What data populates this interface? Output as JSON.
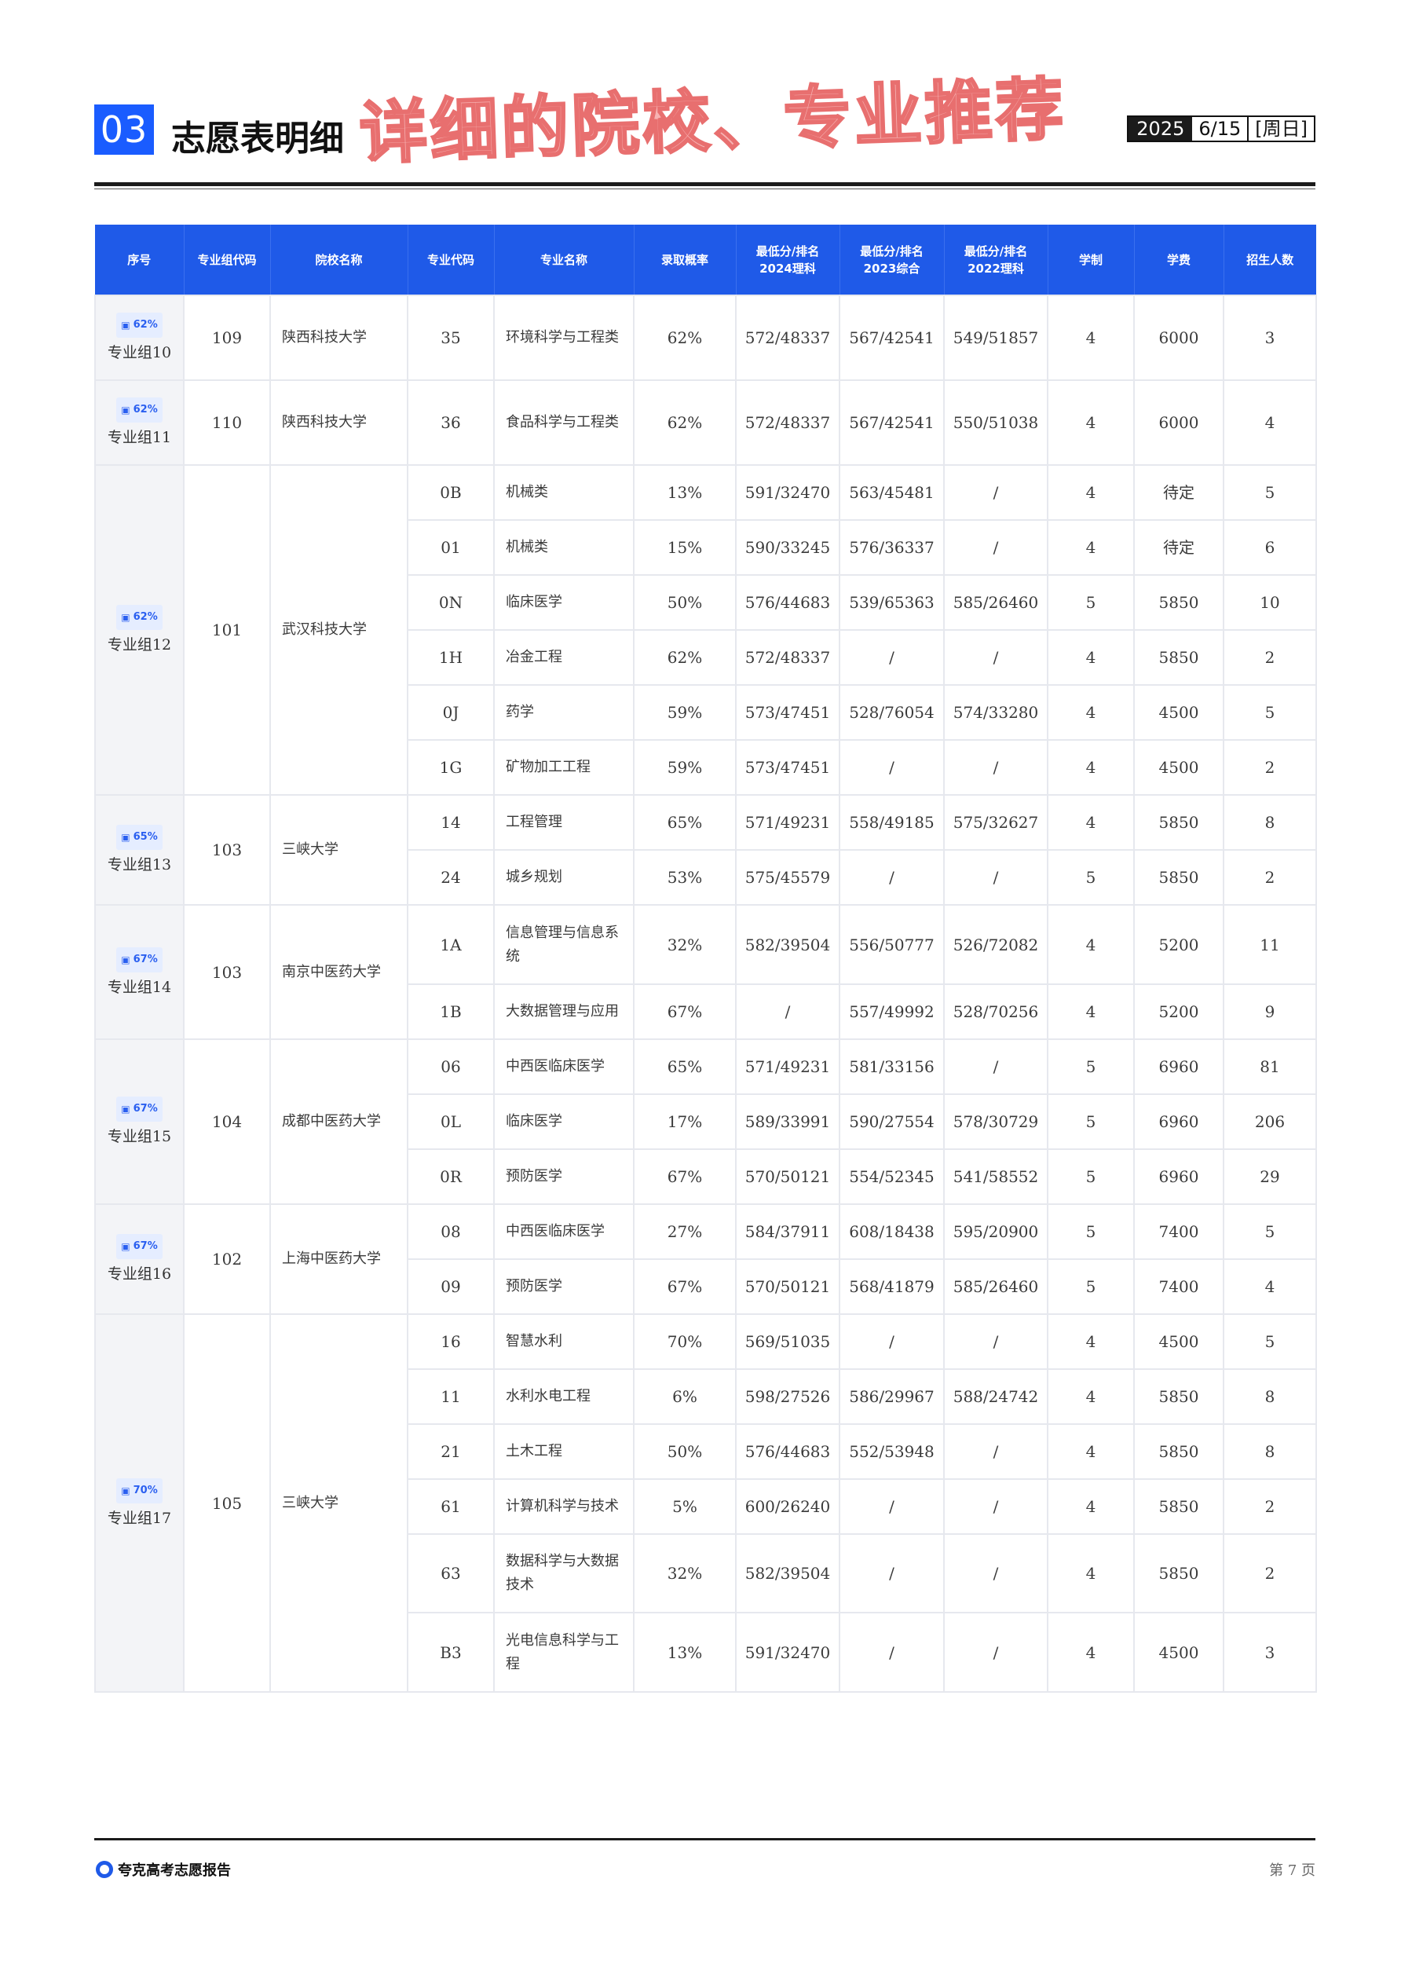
{
  "header": {
    "section_number": "03",
    "section_title": "志愿表明细",
    "overlay_title": "详细的院校、专业推荐",
    "date_year": "2025",
    "date_md": "6/15",
    "date_weekday": "[周日]"
  },
  "table": {
    "columns": [
      "序号",
      "专业组代码",
      "院校名称",
      "专业代码",
      "专业名称",
      "录取概率",
      "最低分/排名\n2024理科",
      "最低分/排名\n2023综合",
      "最低分/排名\n2022理科",
      "学制",
      "学费",
      "招生人数"
    ],
    "groups": [
      {
        "badge": "62%",
        "group": "专业组10",
        "code": "109",
        "school": "陕西科技大学",
        "row_class": "r108",
        "majors": [
          [
            "35",
            "环境科学与工程类",
            "62%",
            "572/48337",
            "567/42541",
            "549/51857",
            "4",
            "6000",
            "3"
          ]
        ]
      },
      {
        "badge": "62%",
        "group": "专业组11",
        "code": "110",
        "school": "陕西科技大学",
        "row_class": "r108",
        "majors": [
          [
            "36",
            "食品科学与工程类",
            "62%",
            "572/48337",
            "567/42541",
            "550/51038",
            "4",
            "6000",
            "4"
          ]
        ]
      },
      {
        "badge": "62%",
        "group": "专业组12",
        "code": "101",
        "school": "武汉科技大学",
        "row_class": "r70",
        "majors": [
          [
            "0B",
            "机械类",
            "13%",
            "591/32470",
            "563/45481",
            "/",
            "4",
            "待定",
            "5"
          ],
          [
            "01",
            "机械类",
            "15%",
            "590/33245",
            "576/36337",
            "/",
            "4",
            "待定",
            "6"
          ],
          [
            "0N",
            "临床医学",
            "50%",
            "576/44683",
            "539/65363",
            "585/26460",
            "5",
            "5850",
            "10"
          ],
          [
            "1H",
            "冶金工程",
            "62%",
            "572/48337",
            "/",
            "/",
            "4",
            "5850",
            "2"
          ],
          [
            "0J",
            "药学",
            "59%",
            "573/47451",
            "528/76054",
            "574/33280",
            "4",
            "4500",
            "5"
          ],
          [
            "1G",
            "矿物加工工程",
            "59%",
            "573/47451",
            "/",
            "/",
            "4",
            "4500",
            "2"
          ]
        ]
      },
      {
        "badge": "65%",
        "group": "专业组13",
        "code": "103",
        "school": "三峡大学",
        "row_class": "r70",
        "majors": [
          [
            "14",
            "工程管理",
            "65%",
            "571/49231",
            "558/49185",
            "575/32627",
            "4",
            "5850",
            "8"
          ],
          [
            "24",
            "城乡规划",
            "53%",
            "575/45579",
            "/",
            "/",
            "5",
            "5850",
            "2"
          ]
        ]
      },
      {
        "badge": "67%",
        "group": "专业组14",
        "code": "103",
        "school": "南京中医药大学",
        "row_class": "mixed14",
        "majors": [
          [
            "1A",
            "信息管理与信息系统",
            "32%",
            "582/39504",
            "556/50777",
            "526/72082",
            "4",
            "5200",
            "11"
          ],
          [
            "1B",
            "大数据管理与应用",
            "67%",
            "/",
            "557/49992",
            "528/70256",
            "4",
            "5200",
            "9"
          ]
        ]
      },
      {
        "badge": "67%",
        "group": "专业组15",
        "code": "104",
        "school": "成都中医药大学",
        "row_class": "r70",
        "majors": [
          [
            "06",
            "中西医临床医学",
            "65%",
            "571/49231",
            "581/33156",
            "/",
            "5",
            "6960",
            "81"
          ],
          [
            "0L",
            "临床医学",
            "17%",
            "589/33991",
            "590/27554",
            "578/30729",
            "5",
            "6960",
            "206"
          ],
          [
            "0R",
            "预防医学",
            "67%",
            "570/50121",
            "554/52345",
            "541/58552",
            "5",
            "6960",
            "29"
          ]
        ]
      },
      {
        "badge": "67%",
        "group": "专业组16",
        "code": "102",
        "school": "上海中医药大学",
        "row_class": "r70",
        "majors": [
          [
            "08",
            "中西医临床医学",
            "27%",
            "584/37911",
            "608/18438",
            "595/20900",
            "5",
            "7400",
            "5"
          ],
          [
            "09",
            "预防医学",
            "67%",
            "570/50121",
            "568/41879",
            "585/26460",
            "5",
            "7400",
            "4"
          ]
        ]
      },
      {
        "badge": "70%",
        "group": "专业组17",
        "code": "105",
        "school": "三峡大学",
        "row_class": "mixed17",
        "majors": [
          [
            "16",
            "智慧水利",
            "70%",
            "569/51035",
            "/",
            "/",
            "4",
            "4500",
            "5"
          ],
          [
            "11",
            "水利水电工程",
            "6%",
            "598/27526",
            "586/29967",
            "588/24742",
            "4",
            "5850",
            "8"
          ],
          [
            "21",
            "土木工程",
            "50%",
            "576/44683",
            "552/53948",
            "/",
            "4",
            "5850",
            "8"
          ],
          [
            "61",
            "计算机科学与技术",
            "5%",
            "600/26240",
            "/",
            "/",
            "4",
            "5850",
            "2"
          ],
          [
            "63",
            "数据科学与大数据技术",
            "32%",
            "582/39504",
            "/",
            "/",
            "4",
            "5850",
            "2"
          ],
          [
            "B3",
            "光电信息科学与工程",
            "13%",
            "591/32470",
            "/",
            "/",
            "4",
            "4500",
            "3"
          ]
        ]
      }
    ]
  },
  "footer": {
    "brand": "夸克高考志愿报告",
    "page": "第 7 页"
  },
  "colors": {
    "accent": "#1f5ae8",
    "badge_bg": "#e5edff",
    "overlay_fill": "#f7b3b3",
    "overlay_stroke": "#e86f6f"
  }
}
